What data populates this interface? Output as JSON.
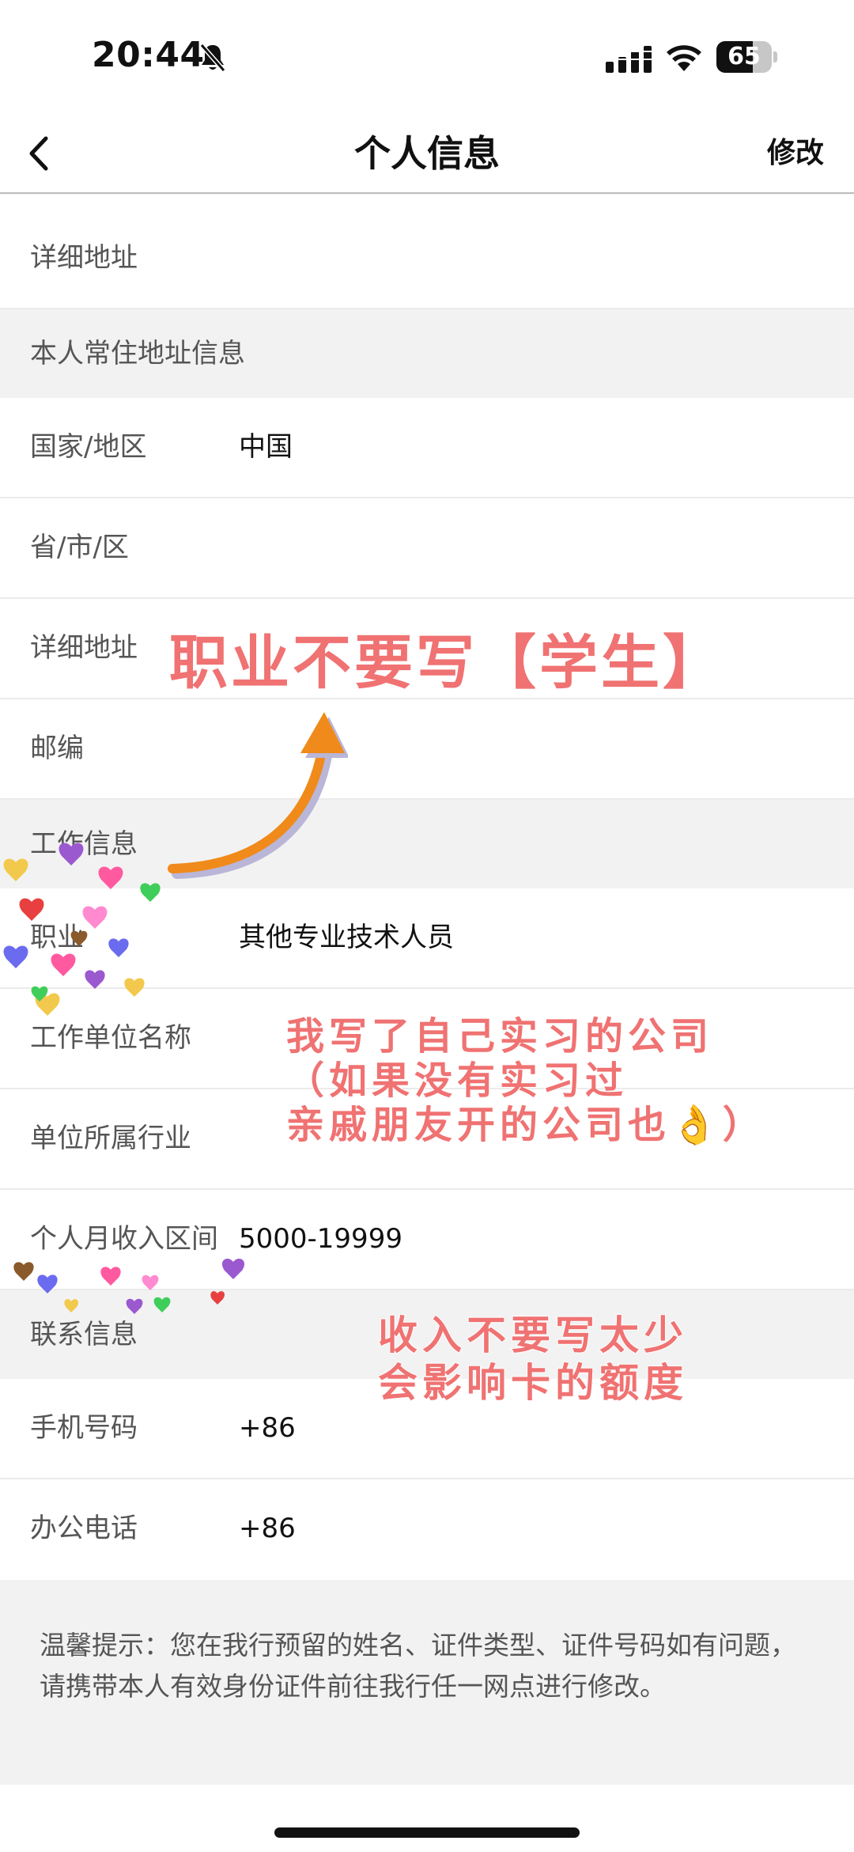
{
  "status_bar": {
    "time": "20:44",
    "battery_level": "65",
    "icons": [
      "bell-slash-icon",
      "signal-icon",
      "wifi-icon",
      "battery-icon"
    ]
  },
  "nav": {
    "title": "个人信息",
    "action": "修改",
    "back_icon": "chevron-left-icon"
  },
  "top_row": {
    "label": "详细地址"
  },
  "residence": {
    "header": "本人常住地址信息",
    "rows": [
      {
        "label": "国家/地区",
        "value": "中国"
      },
      {
        "label": "省/市/区",
        "value": ""
      },
      {
        "label": "详细地址",
        "value": ""
      },
      {
        "label": "邮编",
        "value": ""
      }
    ]
  },
  "work": {
    "header": "工作信息",
    "rows": [
      {
        "label": "职业",
        "value": "其他专业技术人员"
      },
      {
        "label": "工作单位名称",
        "value": ""
      },
      {
        "label": "单位所属行业",
        "value": ""
      },
      {
        "label": "个人月收入区间",
        "value": "5000-19999"
      }
    ]
  },
  "contact": {
    "header": "联系信息",
    "rows": [
      {
        "label": "手机号码",
        "value": "+86"
      },
      {
        "label": "办公电话",
        "value": "+86"
      }
    ]
  },
  "tip": "温馨提示：您在我行预留的姓名、证件类型、证件号码如有问题，请携带本人有效身份证件前往我行任一网点进行修改。",
  "annotations": {
    "note1": "职业不要写【学生】",
    "note2_line1": "我写了自己实习的公司",
    "note2_line2": "（如果没有实习过",
    "note2_line3": "亲戚朋友开的公司也👌）",
    "note3_line1": "收入不要写太少",
    "note3_line2": "会影响卡的额度"
  },
  "colors": {
    "annotation": "#f07272",
    "arrow": "#f08a1a"
  }
}
